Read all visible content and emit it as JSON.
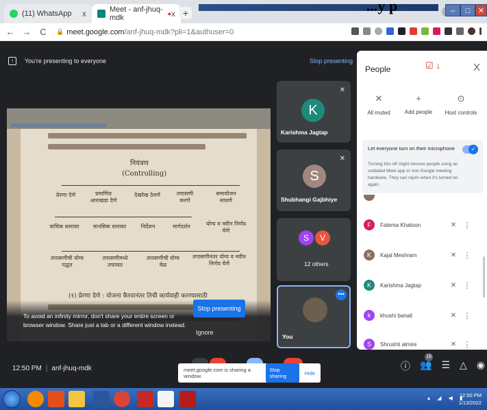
{
  "browser": {
    "tabs": [
      {
        "title": "(11) WhatsApp",
        "close": "x"
      },
      {
        "title": "Meet - anf-jhuq-mdk",
        "close": "x"
      }
    ],
    "new_tab": "+",
    "overlay_text": "...y p",
    "url_host": "meet.google.com",
    "url_path": "/anf-jhuq-mdk?pli=1&authuser=0"
  },
  "meet": {
    "presenting_banner": "You're presenting to everyone",
    "stop_presenting_link": "Stop presenting",
    "infinity_warning": "To avoid an infinity mirror, don't share your entire screen or browser window. Share just a tab or a different window instead.",
    "stop_presenting_button": "Stop presenting",
    "ignore_button": "Ignore",
    "meeting_time": "12:50 PM",
    "meeting_code": "anf-jhuq-mdk",
    "participants_count": "16"
  },
  "shared_doc": {
    "heading_marathi": "नियंत्रण",
    "heading_english": "(Controlling)",
    "boxes": [
      "प्रेरणा देणे",
      "प्रमाणित आराखडा देणे",
      "देखरेख ठेवणे",
      "तपासणी करणे",
      "समायोजन साधणे",
      "वाचिक स्तरावर",
      "मानसिक स्तरावर",
      "निर्देशन",
      "मार्गदर्शन",
      "योग्य व नवीन निर्णय घेणे",
      "तपासणीची योग्य पद्धत",
      "तपासणीमध्ये तफावत",
      "तपासणीची योग्य वेळ",
      "तपासणीनंतर योग्य व नवीन निर्णय घेणे"
    ],
    "paragraph_start": "(१) प्रेरणा देणे : योजना कैरवानंतर तिची कार्यवाही करण्यासाठी"
  },
  "tiles": [
    {
      "initial": "K",
      "name": "Karishma Jagtap",
      "color": "#1e8a7a"
    },
    {
      "initial": "S",
      "name": "Shubhangi Gajbhiye",
      "color": "#a1887f"
    },
    {
      "name": "12 others",
      "initials": [
        "S",
        "V"
      ],
      "colors": [
        "#a142f4",
        "#e8543f"
      ]
    },
    {
      "name": "You"
    }
  ],
  "people_panel": {
    "title": "People",
    "close": "X",
    "controls": [
      {
        "label": "All muted",
        "icon": "mic-off-icon"
      },
      {
        "label": "Add people",
        "icon": "add-person-icon"
      },
      {
        "label": "Host controls",
        "icon": "host-controls-icon"
      }
    ],
    "mic_setting_title": "Let everyone turn on their microphone",
    "mic_setting_desc": "Turning this off might remove people using an outdated Meet app or non-Google meeting hardware. They can rejoin when it's turned on again.",
    "people": [
      {
        "initial": "F",
        "name": "Fatema Khatoon",
        "color": "#d81b60"
      },
      {
        "initial": "K",
        "name": "Kajal Meshram",
        "color": "#8d6e63"
      },
      {
        "initial": "K",
        "name": "Karishma Jagtap",
        "color": "#1e8a7a"
      },
      {
        "initial": "k",
        "name": "khushi banait",
        "color": "#a142f4"
      },
      {
        "initial": "S",
        "name": "Shrushti almire",
        "color": "#a142f4"
      }
    ]
  },
  "share_notice": {
    "text": "meet.google.com is sharing a window.",
    "stop": "Stop sharing",
    "hide": "Hide"
  },
  "taskbar": {
    "time": "12:50 PM",
    "date": "1/13/2022"
  }
}
